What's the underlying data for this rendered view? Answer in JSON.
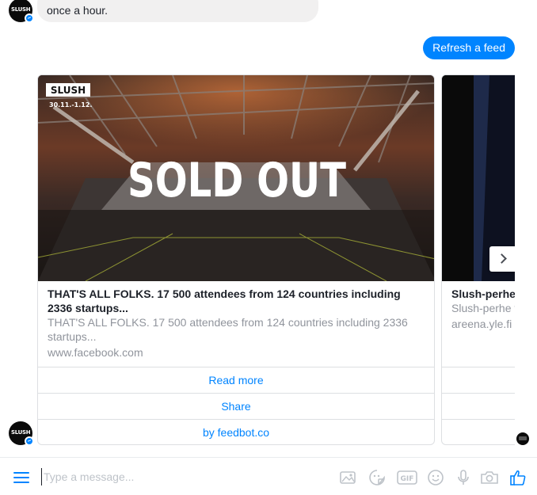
{
  "messages": {
    "bot_text_tail": "once a hour.",
    "user_reply": "Refresh a feed"
  },
  "avatar": {
    "logo_text": "SLUSH"
  },
  "cards": [
    {
      "image_badge_logo": "SLUSH",
      "image_badge_dates": "30.11.-1.12.",
      "image_overlay_text": "SOLD OUT",
      "title": "THAT'S ALL FOLKS. 17 500 attendees from 124 countries including 2336 startups...",
      "subtitle": "THAT'S ALL FOLKS. 17 500 attendees from 124 countries including 2336 startups...",
      "url": "www.facebook.com",
      "buttons": [
        "Read more",
        "Share",
        "by feedbot.co"
      ]
    },
    {
      "title": "Slush-perhe liikuntaan, te",
      "subtitle": "Slush-perhe terveyteen...",
      "url": "areena.yle.fi",
      "buttons": [
        "",
        "",
        ""
      ]
    }
  ],
  "composer": {
    "placeholder": "Type a message...",
    "icons": [
      "menu-icon",
      "image-icon",
      "sticker-icon",
      "gif-icon",
      "emoji-icon",
      "microphone-icon",
      "camera-icon",
      "thumbs-up-icon"
    ],
    "gif_label": "GIF"
  },
  "colors": {
    "accent": "#0084ff",
    "bubble_in": "#f1f0f0",
    "muted_text": "#90949c",
    "border": "#dddfe2"
  }
}
